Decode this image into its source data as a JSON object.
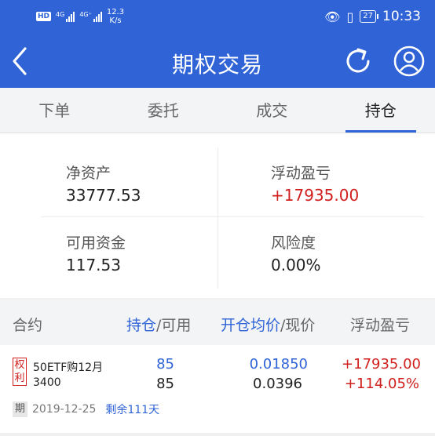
{
  "status_bar": {
    "hd_badge": "HD",
    "sim1_type": "4G",
    "sim2_type": "4G⁺",
    "speed_value": "12.3",
    "speed_unit": "K/s",
    "battery": "27",
    "time": "10:33"
  },
  "header": {
    "title": "期权交易",
    "back_icon": "chevron-left-icon",
    "refresh_icon": "refresh-icon",
    "user_icon": "user-icon",
    "accent_color": "#2f63d6"
  },
  "tabs": [
    {
      "label": "下单",
      "active": false
    },
    {
      "label": "委托",
      "active": false
    },
    {
      "label": "成交",
      "active": false
    },
    {
      "label": "持仓",
      "active": true
    }
  ],
  "summary": {
    "net_assets_label": "净资产",
    "net_assets_value": "33777.53",
    "floating_pl_label": "浮动盈亏",
    "floating_pl_value": "+17935.00",
    "available_funds_label": "可用资金",
    "available_funds_value": "117.53",
    "risk_label": "风险度",
    "risk_value": "0.00%"
  },
  "holdings_header": {
    "contract": "合约",
    "position": "持仓",
    "available": "/可用",
    "open_avg": "开仓均价",
    "current_price": "/现价",
    "floating_pl": "浮动盈亏"
  },
  "holdings": [
    {
      "tag": "权利",
      "name": "50ETF购12月",
      "strike": "3400",
      "position": "85",
      "available": "85",
      "open_avg": "0.01850",
      "current_price": "0.0396",
      "pl_amount": "+17935.00",
      "pl_percent": "+114.05%",
      "expiry_tag": "期",
      "expiry_date": "2019-12-25",
      "days_left": "剩余111天"
    }
  ],
  "colors": {
    "up": "#d0201e",
    "link": "#2f63d6"
  }
}
